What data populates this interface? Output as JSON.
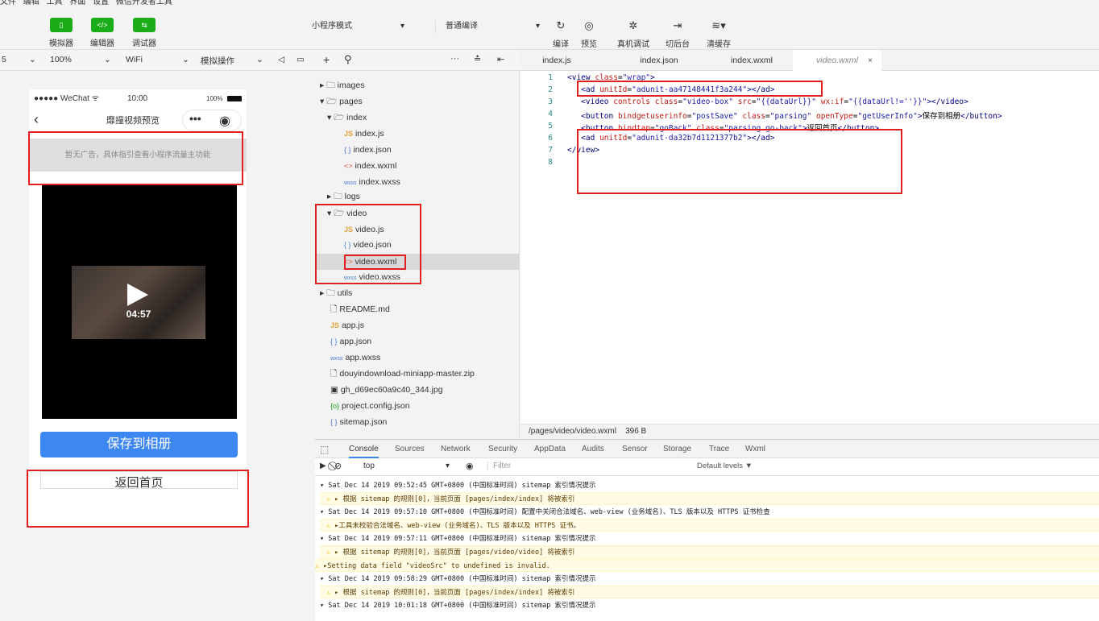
{
  "menubar": [
    "文件",
    "编辑",
    "工具",
    "界面",
    "设置",
    "微信开发者工具"
  ],
  "toolbar": {
    "left_buttons": [
      {
        "icon": "phone-icon",
        "glyph": "▯",
        "label": "模拟器"
      },
      {
        "icon": "code-icon",
        "glyph": "</>",
        "label": "编辑器"
      },
      {
        "icon": "debug-icon",
        "glyph": "⇆",
        "label": "调试器"
      }
    ],
    "mode_select": "小程序模式",
    "compile_select": "普通编译",
    "right_buttons": [
      {
        "icon": "refresh-icon",
        "glyph": "↻",
        "label": "编译"
      },
      {
        "icon": "eye-icon",
        "glyph": "◎",
        "label": "预览"
      },
      {
        "icon": "bug-icon",
        "glyph": "✲",
        "label": "真机调试"
      },
      {
        "icon": "switch-icon",
        "glyph": "⇥",
        "label": "切后台"
      },
      {
        "icon": "layers-icon",
        "glyph": "≋",
        "label": "清缓存"
      }
    ]
  },
  "simbar": {
    "device": "5",
    "zoom": "100%",
    "network": "WiFi",
    "operation": "模拟操作"
  },
  "phone": {
    "carrier": "●●●●● WeChat",
    "time": "10:00",
    "battery": "100%",
    "nav_title": "靡撞视频预览",
    "ad_text": "暂无广告，具体指引查看小程序流量主功能",
    "duration": "04:57",
    "save_btn": "保存到相册",
    "back_btn": "返回首页"
  },
  "tree": [
    {
      "name": "images",
      "type": "folder",
      "open": false
    },
    {
      "name": "pages",
      "type": "folder",
      "open": true
    },
    {
      "name": "index",
      "type": "folder",
      "open": true
    },
    {
      "name": "index.js",
      "type": "js"
    },
    {
      "name": "index.json",
      "type": "json"
    },
    {
      "name": "index.wxml",
      "type": "wxml"
    },
    {
      "name": "index.wxss",
      "type": "wxss"
    },
    {
      "name": "logs",
      "type": "folder",
      "open": false
    },
    {
      "name": "video",
      "type": "folder",
      "open": true
    },
    {
      "name": "video.js",
      "type": "js"
    },
    {
      "name": "video.json",
      "type": "json"
    },
    {
      "name": "video.wxml",
      "type": "wxml"
    },
    {
      "name": "video.wxss",
      "type": "wxss"
    },
    {
      "name": "utils",
      "type": "folder",
      "open": false
    },
    {
      "name": "README.md",
      "type": "file"
    },
    {
      "name": "app.js",
      "type": "js"
    },
    {
      "name": "app.json",
      "type": "json"
    },
    {
      "name": "app.wxss",
      "type": "wxss"
    },
    {
      "name": "douyindownload-miniapp-master.zip",
      "type": "file"
    },
    {
      "name": "gh_d69ec60a9c40_344.jpg",
      "type": "image"
    },
    {
      "name": "project.config.json",
      "type": "config"
    },
    {
      "name": "sitemap.json",
      "type": "json"
    }
  ],
  "tabs": [
    "index.js",
    "index.json",
    "index.wxml",
    "video.wxml"
  ],
  "editor": {
    "lines": [
      "1",
      "2",
      "3",
      "4",
      "5",
      "6",
      "7",
      "8"
    ],
    "status_path": "/pages/video/video.wxml",
    "status_size": "396 B"
  },
  "devtools": {
    "tabs": [
      "Console",
      "Sources",
      "Network",
      "Security",
      "AppData",
      "Audits",
      "Sensor",
      "Storage",
      "Trace",
      "Wxml"
    ],
    "context": "top",
    "filter_placeholder": "Filter",
    "levels": "Default levels ▼",
    "rows": [
      {
        "type": "info",
        "text": "▾ Sat Dec 14 2019 09:52:45 GMT+0800 (中国标准时间) sitemap 索引情况提示"
      },
      {
        "type": "warn",
        "text": "▸ 根据 sitemap 的规则[0]，当前页面 [pages/index/index] 将被索引"
      },
      {
        "type": "info",
        "text": "▾ Sat Dec 14 2019 09:57:10 GMT+0800 (中国标准时间) 配置中关闭合法域名、web-view (业务域名)、TLS 版本以及 HTTPS 证书检查"
      },
      {
        "type": "warn",
        "text": "▸工具未校验合法域名、web-view (业务域名)、TLS 版本以及 HTTPS 证书。"
      },
      {
        "type": "info",
        "text": "▾ Sat Dec 14 2019 09:57:11 GMT+0800 (中国标准时间) sitemap 索引情况提示"
      },
      {
        "type": "warn",
        "text": "▸ 根据 sitemap 的规则[0]，当前页面 [pages/video/video] 将被索引"
      },
      {
        "type": "warn",
        "text": "▸Setting data field \"videoSrc\" to undefined is invalid."
      },
      {
        "type": "info",
        "text": "▾ Sat Dec 14 2019 09:58:29 GMT+0800 (中国标准时间) sitemap 索引情况提示"
      },
      {
        "type": "warn",
        "text": "▸ 根据 sitemap 的规则[0]，当前页面 [pages/index/index] 将被索引"
      },
      {
        "type": "info",
        "text": "▾ Sat Dec 14 2019 10:01:18 GMT+0800 (中国标准时间) sitemap 索引情况提示"
      }
    ]
  }
}
